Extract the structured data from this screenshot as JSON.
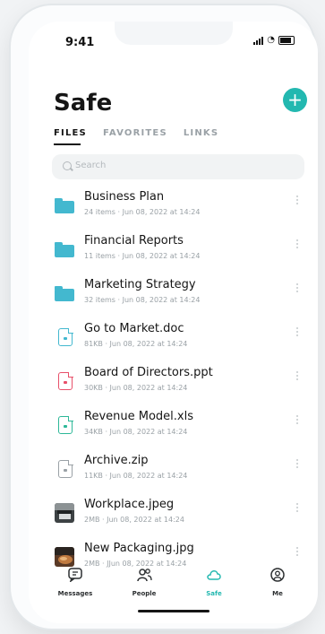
{
  "status_bar": {
    "time": "9:41"
  },
  "header": {
    "title": "Safe"
  },
  "tabs": [
    {
      "label": "FILES",
      "active": true
    },
    {
      "label": "FAVORITES",
      "active": false
    },
    {
      "label": "LINKS",
      "active": false
    }
  ],
  "search": {
    "placeholder": "Search"
  },
  "files": [
    {
      "name": "Business Plan",
      "meta": "24 items · Jun 08, 2022 at 14:24",
      "icon": "folder-icon"
    },
    {
      "name": "Financial Reports",
      "meta": "11 items · Jun 08, 2022 at 14:24",
      "icon": "folder-icon"
    },
    {
      "name": "Marketing Strategy",
      "meta": "32 items · Jun 08, 2022 at 14:24",
      "icon": "folder-icon"
    },
    {
      "name": "Go to Market.doc",
      "meta": "81KB · Jun 08, 2022 at 14:24",
      "icon": "doc-file-icon"
    },
    {
      "name": "Board of Directors.ppt",
      "meta": "30KB · Jun 08, 2022 at 14:24",
      "icon": "ppt-file-icon"
    },
    {
      "name": "Revenue Model.xls",
      "meta": "34KB · Jun 08, 2022 at 14:24",
      "icon": "xls-file-icon"
    },
    {
      "name": "Archive.zip",
      "meta": "11KB · Jun 08, 2022 at 14:24",
      "icon": "zip-file-icon"
    },
    {
      "name": "Workplace.jpeg",
      "meta": "2MB · Jun 08, 2022 at 14:24",
      "icon": "image-thumbnail"
    },
    {
      "name": "New Packaging.jpg",
      "meta": "2MB · JJun 08, 2022 at 14:24",
      "icon": "image-thumbnail"
    }
  ],
  "bottom_nav": [
    {
      "label": "Messages",
      "icon": "chat-icon",
      "active": false
    },
    {
      "label": "People",
      "icon": "people-icon",
      "active": false
    },
    {
      "label": "Safe",
      "icon": "cloud-icon",
      "active": true
    },
    {
      "label": "Me",
      "icon": "user-icon",
      "active": false
    }
  ],
  "colors": {
    "accent": "#23b8b0",
    "folder": "#43b8cf",
    "doc": "#43b8cf",
    "ppt": "#e8506a",
    "xls": "#2db898",
    "zip": "#9aa1a6"
  }
}
